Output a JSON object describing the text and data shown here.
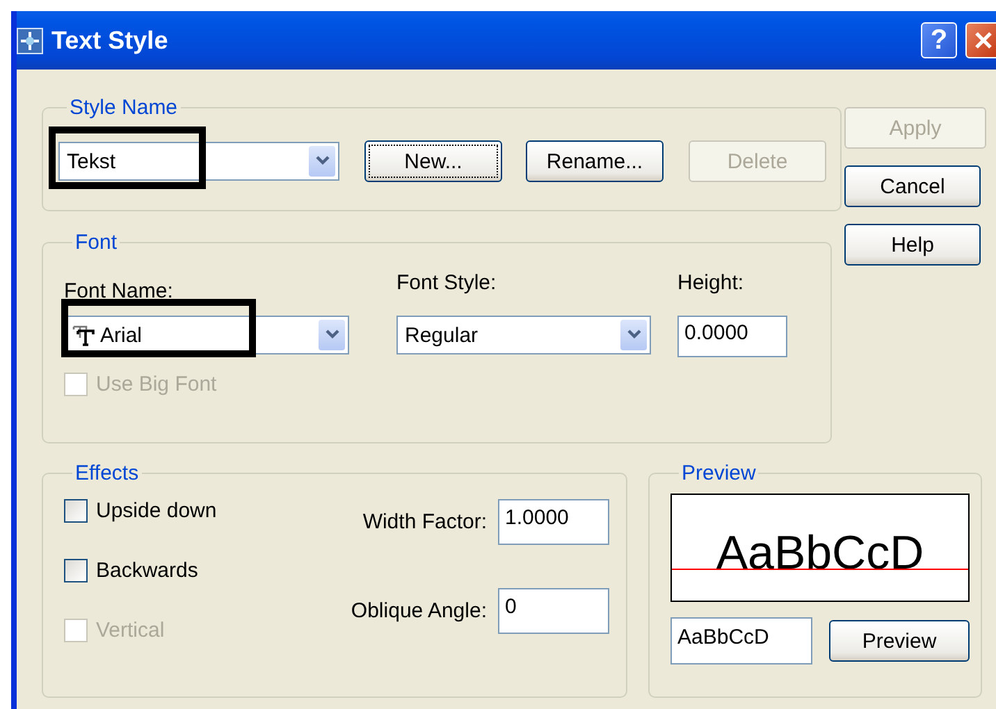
{
  "window": {
    "title": "Text Style",
    "help_glyph": "?"
  },
  "style_name": {
    "legend": "Style Name",
    "combo": {
      "value": "Tekst",
      "highlighted": true
    },
    "buttons": [
      {
        "label": "New...",
        "disabled": false,
        "focused": true
      },
      {
        "label": "Rename...",
        "disabled": false,
        "focused": false
      },
      {
        "label": "Delete",
        "disabled": true,
        "focused": false
      }
    ]
  },
  "actions": [
    {
      "label": "Apply",
      "disabled": true
    },
    {
      "label": "Cancel",
      "disabled": false
    },
    {
      "label": "Help",
      "disabled": false
    }
  ],
  "font": {
    "legend": "Font",
    "font_name": {
      "label": "Font Name:",
      "value": "Arial",
      "highlighted": true
    },
    "font_style": {
      "label": "Font Style:",
      "value": "Regular"
    },
    "height": {
      "label": "Height:",
      "value": "0.0000"
    },
    "big_font": {
      "label": "Use Big Font",
      "checked": false,
      "disabled": true
    }
  },
  "effects": {
    "legend": "Effects",
    "checks": [
      {
        "label": "Upside down",
        "checked": false,
        "disabled": false
      },
      {
        "label": "Backwards",
        "checked": false,
        "disabled": false
      },
      {
        "label": "Vertical",
        "checked": false,
        "disabled": true
      }
    ],
    "fields": [
      {
        "label": "Width Factor:",
        "value": "1.0000"
      },
      {
        "label": "Oblique Angle:",
        "value": "0"
      }
    ]
  },
  "preview": {
    "legend": "Preview",
    "sample": "AaBbCcD",
    "input": "AaBbCcD",
    "button": "Preview"
  }
}
